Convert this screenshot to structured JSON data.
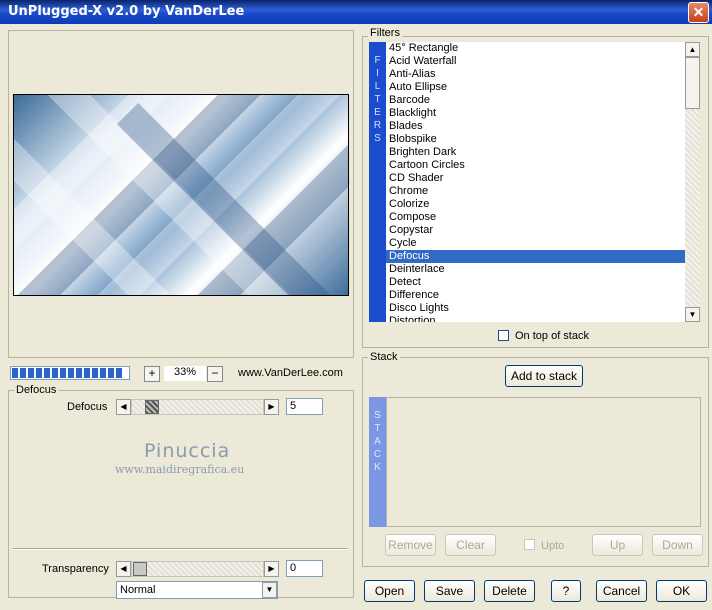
{
  "window": {
    "title": "UnPlugged-X v2.0 by VanDerLee",
    "close_glyph": "✕"
  },
  "preview": {
    "zoom_value": "33%",
    "zoom_in_glyph": "+",
    "zoom_out_glyph": "−",
    "website": "www.VanDerLee.com",
    "progress": 1.0
  },
  "filters": {
    "legend": "Filters",
    "vertical_label": [
      "F",
      "I",
      "L",
      "T",
      "E",
      "R",
      "S"
    ],
    "items": [
      "45° Rectangle",
      "Acid Waterfall",
      "Anti-Alias",
      "Auto Ellipse",
      "Barcode",
      "Blacklight",
      "Blades",
      "Blobspike",
      "Brighten Dark",
      "Cartoon Circles",
      "CD Shader",
      "Chrome",
      "Colorize",
      "Compose",
      "Copystar",
      "Cycle",
      "Defocus",
      "Deinterlace",
      "Detect",
      "Difference",
      "Disco Lights",
      "Distortion"
    ],
    "selected": "Defocus",
    "on_top_label": "On top of stack",
    "scroll_up_glyph": "▲",
    "scroll_down_glyph": "▼"
  },
  "settings": {
    "legend": "Defocus",
    "defocus_label": "Defocus",
    "defocus_value": "5",
    "left_glyph": "◀",
    "right_glyph": "▶"
  },
  "watermark": {
    "name": "Pinuccia",
    "url": "www.maidiregrafica.eu"
  },
  "transparency": {
    "label": "Transparency",
    "value": "0",
    "blend_mode": "Normal",
    "dropdown_glyph": "▼"
  },
  "stack": {
    "legend": "Stack",
    "add_button": "Add to stack",
    "vertical_label": [
      "S",
      "T",
      "A",
      "C",
      "K"
    ],
    "remove": "Remove",
    "clear": "Clear",
    "upto": "Upto",
    "up": "Up",
    "down": "Down"
  },
  "footer": {
    "open": "Open",
    "save": "Save",
    "delete": "Delete",
    "help": "?",
    "cancel": "Cancel",
    "ok": "OK"
  },
  "colors": {
    "title_bar": "#0a246a",
    "selection": "#316ac5",
    "vertical_label_bg": "#1c4cce",
    "stack_label_bg": "#7b96e3"
  }
}
